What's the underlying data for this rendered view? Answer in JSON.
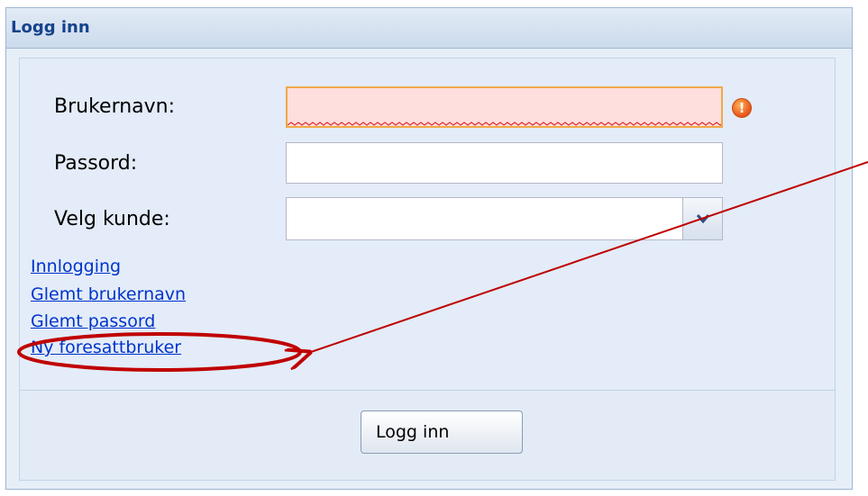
{
  "panel": {
    "title": "Logg inn"
  },
  "form": {
    "username": {
      "label": "Brukernavn:",
      "value": "",
      "state": "invalid",
      "error_icon": "exclamation-icon"
    },
    "password": {
      "label": "Passord:",
      "value": ""
    },
    "customer": {
      "label": "Velg kunde:",
      "selected": "",
      "dropdown_icon": "chevron-down-icon"
    }
  },
  "links": [
    {
      "label": "Innlogging"
    },
    {
      "label": "Glemt brukernavn"
    },
    {
      "label": "Glemt passord"
    },
    {
      "label": "Ny foresattbruker"
    }
  ],
  "footer": {
    "login_button": "Logg inn"
  },
  "colors": {
    "header_text": "#15428b",
    "link": "#0033cc",
    "error_field_bg": "#ffdede",
    "error_field_border": "#f0a848",
    "annotation": "#c00000"
  }
}
